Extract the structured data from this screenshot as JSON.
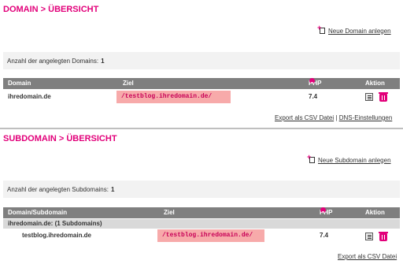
{
  "domain_section": {
    "title": "DOMAIN > ÜBERSICHT",
    "new_link": "Neue Domain anlegen",
    "count_label": "Anzahl der angelegten Domains:",
    "count_value": "1",
    "columns": {
      "domain": "Domain",
      "ziel": "Ziel",
      "php": "PHP",
      "aktion": "Aktion"
    },
    "rows": [
      {
        "domain": "ihredomain.de",
        "ziel": "/testblog.ihredomain.de/",
        "php": "7.4"
      }
    ],
    "export_link": "Export als CSV Datei",
    "separator": "|",
    "dns_link": "DNS-Einstellungen"
  },
  "subdomain_section": {
    "title": "SUBDOMAIN > ÜBERSICHT",
    "new_link": "Neue Subdomain anlegen",
    "count_label": "Anzahl der angelegten Subdomains:",
    "count_value": "1",
    "columns": {
      "domain": "Domain/Subdomain",
      "ziel": "Ziel",
      "php": "PHP",
      "aktion": "Aktion"
    },
    "group_label": "ihredomain.de: (1 Subdomains)",
    "rows": [
      {
        "domain": "testblog.ihredomain.de",
        "ziel": "/testblog.ihredomain.de/",
        "php": "7.4"
      }
    ],
    "export_link": "Export als CSV Datei"
  },
  "icons": {
    "add": "add-document-icon",
    "sort": "sort-down-icon",
    "edit": "edit-icon",
    "delete": "trash-icon"
  },
  "colors": {
    "accent": "#e2007a",
    "header_bg": "#7f7f7f",
    "ziel_highlight": "#f7aaaa",
    "count_bg": "#f2f2f2"
  }
}
